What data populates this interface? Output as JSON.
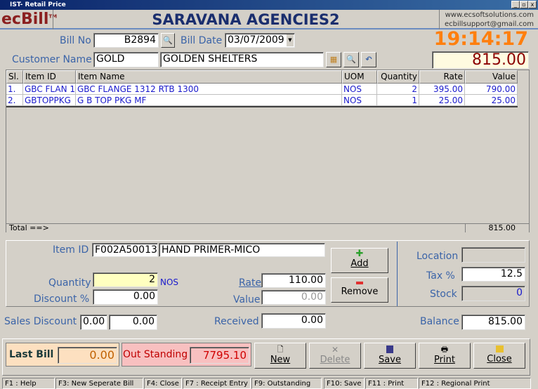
{
  "window": {
    "title": "IST- Retail Price",
    "controls": [
      "_",
      "▫",
      "x"
    ]
  },
  "header": {
    "logo": "ecBill",
    "logo_tm": "TM",
    "company": "SARAVANA AGENCIES2",
    "website": "www.ecsoftsolutions.com",
    "email": "ecbillsupport@gmail.com"
  },
  "bill": {
    "bill_no_label": "Bill No",
    "bill_no": "B2894",
    "bill_date_label": "Bill Date",
    "bill_date": "03/07/2009",
    "customer_label": "Customer Name",
    "customer_code": "GOLD",
    "customer_name": "GOLDEN SHELTERS",
    "clock": "19:14:17",
    "total_amount": "815.00"
  },
  "grid": {
    "columns": [
      "Sl.",
      "Item ID",
      "Item Name",
      "UOM",
      "Quantity",
      "Rate",
      "Value"
    ],
    "rows": [
      [
        "1.",
        "GBC FLAN 1",
        "GBC FLANGE 1312 RTB 1300",
        "NOS",
        "2",
        "395.00",
        "790.00"
      ],
      [
        "2.",
        "GBTOPPKG",
        "G B TOP PKG MF",
        "NOS",
        "1",
        "25.00",
        "25.00"
      ]
    ],
    "total_label": "Total ==>",
    "total_value": "815.00"
  },
  "entry": {
    "item_id_label": "Item ID",
    "item_id": "F002A50013",
    "item_name": "HAND PRIMER-MICO",
    "quantity_label": "Quantity",
    "quantity": "2",
    "uom": "NOS",
    "discount_label": "Discount %",
    "discount": "0.00",
    "rate_label": "Rate",
    "rate": "110.00",
    "value_label": "Value",
    "value": "0.00",
    "add_label": "Add",
    "remove_label": "Remove",
    "location_label": "Location",
    "location": "",
    "tax_label": "Tax %",
    "tax": "12.5",
    "stock_label": "Stock",
    "stock": "0"
  },
  "summary": {
    "sales_discount_label": "Sales Discount",
    "sales_discount_pct": "0.00",
    "sales_discount_amt": "0.00",
    "received_label": "Received",
    "received": "0.00",
    "balance_label": "Balance",
    "balance": "815.00"
  },
  "footer": {
    "last_bill_label": "Last Bill",
    "last_bill": "0.00",
    "outstanding_label": "Out Standing",
    "outstanding": "7795.10",
    "buttons": [
      "New",
      "Delete",
      "Save",
      "Print",
      "Close"
    ]
  },
  "statusbar": [
    "F1 : Help",
    "F3: New Seperate Bill",
    "F4: Close",
    "F7 : Receipt Entry",
    "F9: Outstanding",
    "F10: Save",
    "F11 : Print",
    "F12 : Regional Print"
  ],
  "colors": {
    "title_blue": "#1a2e6e",
    "clock_orange": "#ff7f0e",
    "amount_red": "#8b0000",
    "label_blue": "#3b64a8"
  }
}
